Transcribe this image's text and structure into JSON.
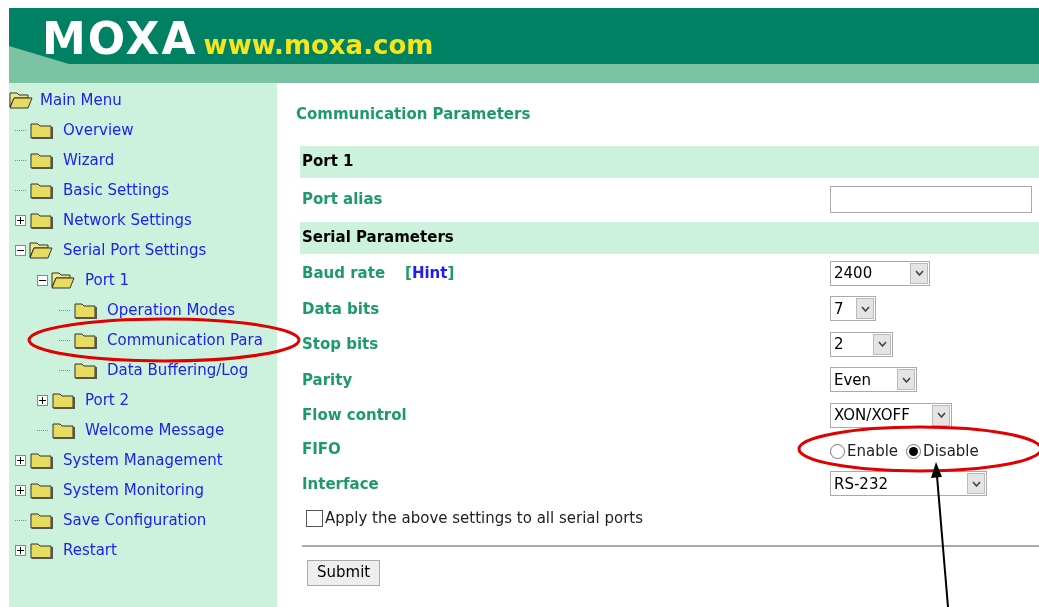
{
  "header": {
    "logo": "MOXA",
    "url": "www.moxa.com"
  },
  "sidebar": {
    "root": {
      "label": "Main Menu",
      "children": [
        {
          "label": "Overview"
        },
        {
          "label": "Wizard"
        },
        {
          "label": "Basic Settings"
        },
        {
          "label": "Network Settings",
          "expanded": false
        },
        {
          "label": "Serial Port Settings",
          "expanded": true,
          "children": [
            {
              "label": "Port 1",
              "expanded": true,
              "children": [
                {
                  "label": "Operation Modes"
                },
                {
                  "label": "Communication Para"
                },
                {
                  "label": "Data Buffering/Log"
                }
              ]
            },
            {
              "label": "Port 2",
              "expanded": false
            },
            {
              "label": "Welcome Message"
            }
          ]
        },
        {
          "label": "System Management",
          "expanded": false
        },
        {
          "label": "System Monitoring",
          "expanded": false
        },
        {
          "label": "Save Configuration"
        },
        {
          "label": "Restart",
          "expanded": false
        }
      ]
    }
  },
  "page_title": "Communication Parameters",
  "rows": [
    {
      "kind": "section",
      "label": "Port 1"
    },
    {
      "kind": "text",
      "label": "Port alias",
      "value": ""
    },
    {
      "kind": "section",
      "label": "Serial Parameters"
    },
    {
      "kind": "select",
      "label": "Baud rate",
      "hint": {
        "before": "[",
        "label": "Hint",
        "after": "]"
      },
      "value": "2400"
    },
    {
      "kind": "select",
      "label": "Data bits",
      "value": "7"
    },
    {
      "kind": "select",
      "label": "Stop bits",
      "value": "2"
    },
    {
      "kind": "select",
      "label": "Parity",
      "value": "Even"
    },
    {
      "kind": "select",
      "label": "Flow control",
      "value": "XON/XOFF"
    },
    {
      "kind": "radio",
      "label": "FIFO",
      "options": [
        {
          "label": "Enable",
          "selected": false
        },
        {
          "label": "Disable",
          "selected": true
        }
      ]
    },
    {
      "kind": "select",
      "label": "Interface",
      "value": "RS-232"
    }
  ],
  "apply_all": {
    "label": "Apply the above settings to all serial ports",
    "checked": false
  },
  "submit": "Submit"
}
